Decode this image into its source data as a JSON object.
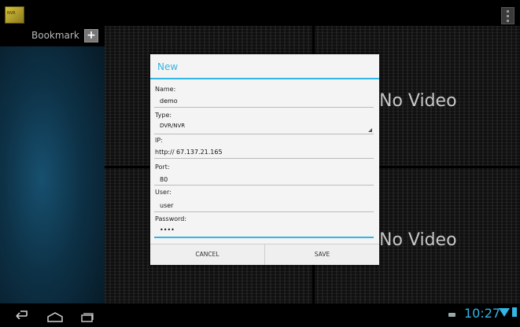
{
  "app": {
    "logo_label": "NVR"
  },
  "sidebar": {
    "title": "Bookmark",
    "add_label": "+"
  },
  "video": {
    "tile_label": "No Video"
  },
  "dialog": {
    "title": "New",
    "name_label": "Name:",
    "name_value": "demo",
    "type_label": "Type:",
    "type_value": "DVR/NVR",
    "ip_label": "IP:",
    "ip_value": "http://  67.137.21.165",
    "port_label": "Port:",
    "port_value": "80",
    "user_label": "User:",
    "user_value": "user",
    "password_label": "Password:",
    "password_value": "••••",
    "cancel_label": "CANCEL",
    "save_label": "SAVE"
  },
  "statusbar": {
    "time": "10:27"
  },
  "colors": {
    "accent": "#33b5e5"
  }
}
